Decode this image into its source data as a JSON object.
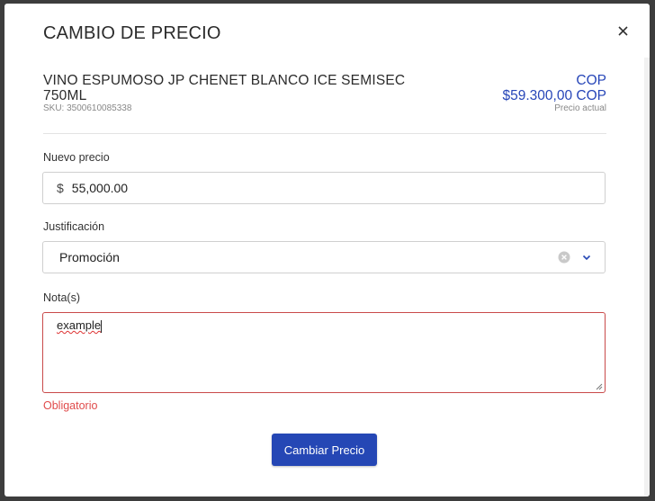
{
  "modal": {
    "title": "CAMBIO DE PRECIO",
    "close_icon": "close-icon"
  },
  "product": {
    "name": "VINO ESPUMOSO JP CHENET BLANCO ICE SEMISEC 750ML",
    "sku": "SKU: 3500610085338",
    "currency": "COP",
    "current_price": "$59.300,00 COP",
    "current_price_caption": "Precio actual"
  },
  "form": {
    "new_price": {
      "label": "Nuevo precio",
      "symbol": "$",
      "value": "55,000.00"
    },
    "justification": {
      "label": "Justificación",
      "value": "Promoción",
      "clear_icon": "clear-icon",
      "chevron_icon": "chevron-down-icon"
    },
    "notes": {
      "label": "Nota(s)",
      "value": "example",
      "error": "Obligatorio"
    },
    "submit_label": "Cambiar Precio"
  },
  "colors": {
    "accent": "#2547b5",
    "price": "#2746b8",
    "error": "#e04b4b"
  }
}
